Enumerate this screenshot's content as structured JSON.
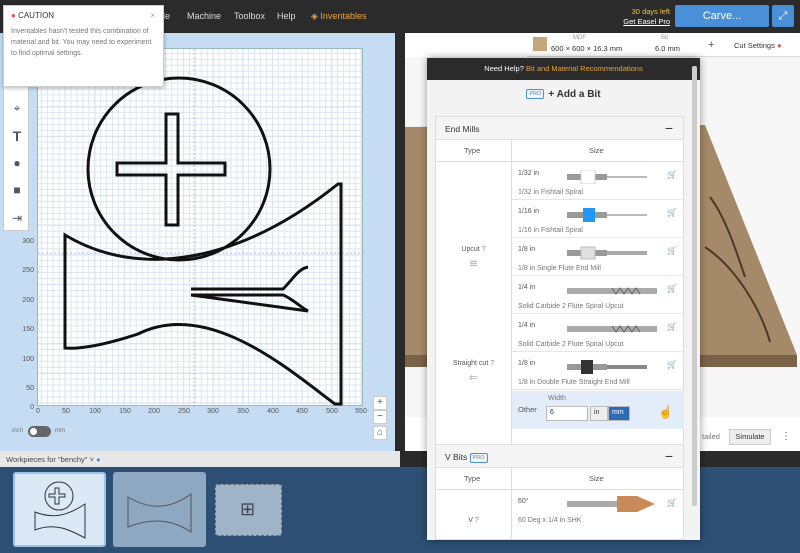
{
  "topbar": {
    "nav": [
      "de",
      "Machine",
      "Toolbox",
      "Help"
    ],
    "inventables": "Inventables",
    "trial_days": "30 days left",
    "trial_link": "Get Easel Pro",
    "carve": "Carve..."
  },
  "caution": {
    "title": "CAUTION",
    "body": "Inventables hasn't tested this combination of material and bit. You may need to experiment to find optimal settings.",
    "close": "×"
  },
  "tools": [
    "shapes",
    "target",
    "T",
    "apple",
    "box",
    "import"
  ],
  "canvas": {
    "x_ticks": [
      "0",
      "50",
      "100",
      "150",
      "200",
      "250",
      "300",
      "350",
      "400",
      "450",
      "500",
      "550"
    ],
    "y_ticks": [
      "300",
      "250",
      "200",
      "150",
      "100",
      "50",
      "0"
    ]
  },
  "units": {
    "inch": "inch",
    "mm": "mm"
  },
  "zoom": {
    "plus": "+",
    "minus": "−",
    "home": "⌂"
  },
  "workpieces": {
    "label": "Workpieces for \"benchy\"",
    "items": [
      "design-1",
      "design-2",
      "add-new"
    ]
  },
  "material": {
    "name": "MDF",
    "dims": "600 × 600 × 16.3 mm",
    "bit_label": "Bit",
    "bit_value": "6.0 mm",
    "plus": "+",
    "cut_settings": "Cut Settings"
  },
  "view": {
    "detailed": "tailed",
    "simulate": "Simulate",
    "more": "⋮"
  },
  "bitpanel": {
    "help": "Need Help?",
    "help_link": "Bit and Material Recommendations",
    "pro": "PRO",
    "add_bit": "+ Add a Bit",
    "end_mills": {
      "title": "End Mills",
      "collapse": "−",
      "type_col": "Type",
      "size_col": "Size",
      "upcut_label": "Upcut",
      "straight_label": "Straight cut",
      "bits": [
        {
          "size": "1/32 in",
          "name": "1/32 in Fishtail Spiral",
          "color": "#ffffff"
        },
        {
          "size": "1/16 in",
          "name": "1/16 in Fishtail Spiral",
          "color": "#2196f3"
        },
        {
          "size": "1/8 in",
          "name": "1/8 in Single Flute End Mill",
          "color": "#e0e0e0"
        },
        {
          "size": "1/4 in",
          "name": "Solid Carbide 2 Flute Spiral Upcut",
          "color": "#cccccc"
        },
        {
          "size": "1/4 in",
          "name": "Solid Carbide 2 Flute Spiral Upcut",
          "color": "#cccccc"
        },
        {
          "size": "1/8 in",
          "name": "1/8 in Double Flute Straight End Mill",
          "color": "#333333"
        }
      ],
      "other": {
        "label": "Other",
        "width_label": "Width",
        "width_value": "6",
        "in": "in",
        "mm": "mm"
      }
    },
    "v_bits": {
      "title": "V Bits",
      "pro": "PRO",
      "collapse": "−",
      "type_col": "Type",
      "size_col": "Size",
      "v_label": "V",
      "bit_size": "60°",
      "bit_name": "60 Deg x 1/4 in SHK"
    }
  }
}
